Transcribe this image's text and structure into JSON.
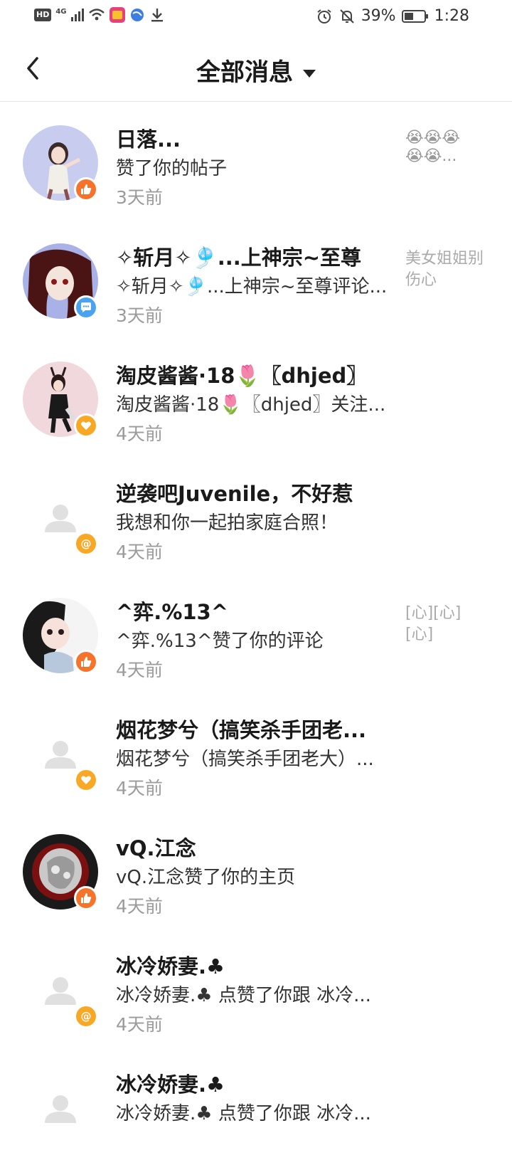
{
  "status_bar": {
    "hd": "HD",
    "network": "4G",
    "battery": "39%",
    "time": "1:28"
  },
  "nav": {
    "title": "全部消息"
  },
  "messages": [
    {
      "name": "日落...",
      "text": "赞了你的帖子",
      "time": "3天前",
      "side": "😭😭😭😭😭...",
      "badge": "like",
      "avatar": "anime-blue"
    },
    {
      "name": "✧斩月✧🎐...上神宗~至尊",
      "text": "✧斩月✧🎐...上神宗~至尊评论...",
      "time": "3天前",
      "side": "美女姐姐别伤心",
      "badge": "comment",
      "avatar": "anime-red"
    },
    {
      "name": "淘皮酱酱·18🌷〖dhjed〗",
      "text": "淘皮酱酱·18🌷〖dhjed〗关注...",
      "time": "4天前",
      "side": "",
      "badge": "follow",
      "avatar": "anime-pink"
    },
    {
      "name": "逆袭吧Juvenile，不好惹",
      "text": "我想和你一起拍家庭合照！",
      "time": "4天前",
      "side": "",
      "badge": "mention",
      "avatar": "default"
    },
    {
      "name": "^弈.%13^",
      "text": "^弈.%13^赞了你的评论",
      "time": "4天前",
      "side": "[心][心][心]",
      "badge": "like",
      "avatar": "anime-white"
    },
    {
      "name": "烟花梦兮（搞笑杀手团老...",
      "text": "烟花梦兮（搞笑杀手团老大）...",
      "time": "4天前",
      "side": "",
      "badge": "follow",
      "avatar": "default"
    },
    {
      "name": "vQ.江念",
      "text": "vQ.江念赞了你的主页",
      "time": "4天前",
      "side": "",
      "badge": "like",
      "avatar": "dark"
    },
    {
      "name": "冰冷娇妻.♣",
      "text": "冰冷娇妻.♣ 点赞了你跟 冰冷...",
      "time": "4天前",
      "side": "",
      "badge": "mention",
      "avatar": "default"
    },
    {
      "name": "冰冷娇妻.♣",
      "text": "冰冷娇妻.♣ 点赞了你跟 冰冷...",
      "time": "",
      "side": "",
      "badge": "",
      "avatar": "default"
    }
  ],
  "colors": {
    "like": "#f5732a",
    "comment": "#4aa3f0",
    "follow": "#f9a825",
    "mention": "#f9a825"
  }
}
